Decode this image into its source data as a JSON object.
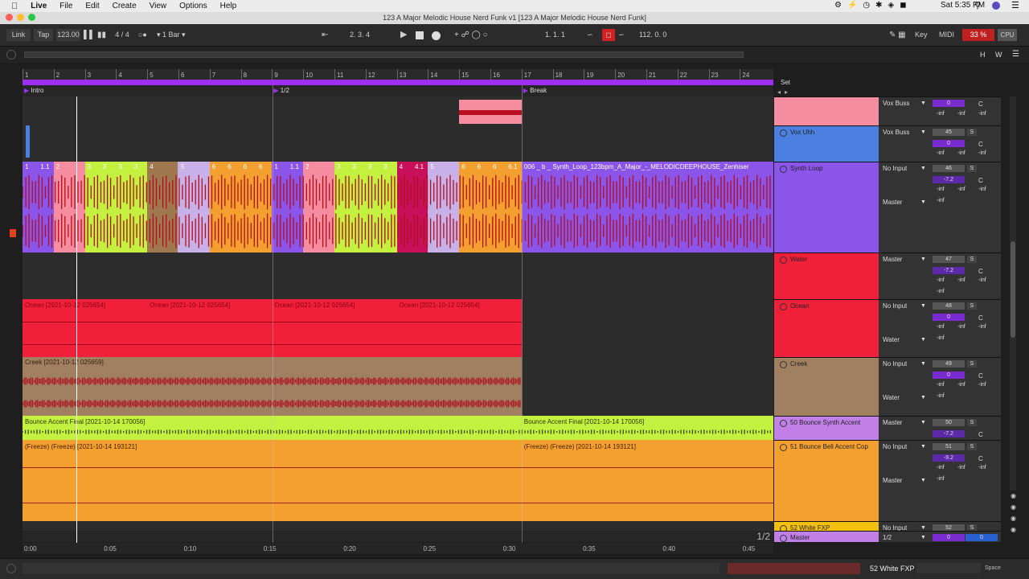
{
  "menubar": {
    "app": "Live",
    "items": [
      "File",
      "Edit",
      "Create",
      "View",
      "Options",
      "Help"
    ],
    "clock": "Sat 5:35 PM"
  },
  "window": {
    "title": "123 A Major Melodic House Nerd Funk v1  [123 A Major Melodic House Nerd Funk]"
  },
  "transport": {
    "link": "Link",
    "tap": "Tap",
    "tempo": "123.00",
    "signature": "4 / 4",
    "quantize": "1 Bar",
    "position": "2.  3.  4",
    "loop_start": "1.   1.   1",
    "loop_length": "112.   0.   0",
    "key": "Key",
    "midi": "MIDI",
    "cpu_pct": "33 %",
    "cpu": "CPU"
  },
  "view": {
    "h": "H",
    "w": "W",
    "set": "Set"
  },
  "ruler": [
    "1",
    "2",
    "3",
    "4",
    "5",
    "6",
    "7",
    "8",
    "9",
    "10",
    "11",
    "12",
    "13",
    "14",
    "15",
    "16",
    "17",
    "18",
    "19",
    "20",
    "21",
    "22",
    "23",
    "24"
  ],
  "locators": [
    {
      "label": "Intro",
      "bar": 1
    },
    {
      "label": "1/2",
      "bar": 9
    },
    {
      "label": "Break",
      "bar": 17
    }
  ],
  "clips": {
    "synth_loop_bars": [
      "1",
      "1.1",
      "2",
      "",
      "3",
      "3",
      "3",
      "3",
      "4",
      "",
      "5",
      "",
      "6",
      "6",
      "6",
      "6",
      "1",
      "1.1",
      "2",
      "",
      "3",
      "3",
      "3",
      "3",
      "4",
      "4.1",
      "5",
      "",
      "6",
      "6",
      "6",
      "6.1"
    ],
    "synth_loop_name": "006 _ b _ Synth_Loop_123bpm_A_Major_-_MELODICDEEPHOUSE_Zenhiser",
    "ocean": [
      "Ocean [2021-10-12 025654]",
      "Ocean [2021-10-12 025654]",
      "Ocean [2021-10-12 025654]",
      "Ocean [2021-10-12 025654]"
    ],
    "creek": "Creek [2021-10-12 025659]",
    "bounce": [
      "Bounce Accent Final [2021-10-14 170056]",
      "Bounce Accent Final [2021-10-14 170056]"
    ],
    "freeze": [
      "(Freeze) (Freeze) [2021-10-14 193121]",
      "(Freeze) (Freeze) [2021-10-14 193121]"
    ]
  },
  "tracks": [
    {
      "name": "",
      "color": "#f68ca0",
      "io_top": "Vox Buss",
      "vol": "0",
      "vol_bg": "#7a2bd0",
      "s": "",
      "pan": "C",
      "infs": [
        "-inf",
        "-inf",
        "-inf"
      ]
    },
    {
      "name": "Vox Uhh",
      "color": "#4b7fe0",
      "io_top": "Vox Buss",
      "vol": "0",
      "vol_bg": "#7a2bd0",
      "s": "S",
      "num": "45",
      "pan": "C",
      "infs": [
        "-inf",
        "-inf",
        "-inf"
      ]
    },
    {
      "name": "Synth Loop",
      "color": "#8a55e8",
      "io_top": "No Input",
      "io_bottom": "Master",
      "num": "46",
      "vol": "-7.2",
      "vol_bg": "#5c2aa8",
      "s": "S",
      "pan": "C",
      "infs": [
        "-inf",
        "-inf",
        "-inf"
      ],
      "inf_solo": "-inf"
    },
    {
      "name": "Water",
      "color": "#f0203a",
      "io_top": "Master",
      "num": "47",
      "vol": "-7.2",
      "vol_bg": "#5c2aa8",
      "s": "S",
      "pan": "C",
      "infs": [
        "-inf",
        "-inf",
        "-inf"
      ],
      "inf_solo": "-inf"
    },
    {
      "name": "Ocean",
      "color": "#f0203a",
      "io_top": "No Input",
      "io_bottom": "Water",
      "num": "48",
      "vol": "0",
      "vol_bg": "#7a2bd0",
      "s": "S",
      "pan": "C",
      "infs": [
        "-inf",
        "-inf",
        "-inf"
      ],
      "inf_solo": "-inf"
    },
    {
      "name": "Creek",
      "color": "#a08060",
      "io_top": "No Input",
      "io_bottom": "Water",
      "num": "49",
      "vol": "0",
      "vol_bg": "#7a2bd0",
      "s": "S",
      "pan": "C",
      "infs": [
        "-inf",
        "-inf",
        "-inf"
      ],
      "inf_solo": "-inf"
    },
    {
      "name": "50 Bounce Synth Accent",
      "color": "#c080e8",
      "io_top": "Master",
      "num": "50",
      "vol": "-7.2",
      "vol_bg": "#5c2aa8",
      "s": "S",
      "pan": "C"
    },
    {
      "name": "51 Bounce Bell Accent Cop",
      "color": "#f4a030",
      "io_top": "No Input",
      "io_bottom": "Master",
      "num": "51",
      "vol": "-9.2",
      "vol_bg": "#5c2aa8",
      "s": "S",
      "pan": "C",
      "infs": [
        "-inf",
        "-inf",
        "-inf"
      ],
      "inf_solo": "-inf"
    },
    {
      "name": "52 White FXP",
      "color": "#f4c010",
      "io_top": "No Input",
      "num": "52",
      "s": "S"
    },
    {
      "name": "Master",
      "color": "#c080e8",
      "io_top": "1/2",
      "vol": "0",
      "vol_bg": "#7a2bd0",
      "vol2": "0"
    }
  ],
  "timeaxis": [
    "0:00",
    "0:05",
    "0:10",
    "0:15",
    "0:20",
    "0:25",
    "0:30",
    "0:35",
    "0:40",
    "0:45"
  ],
  "zoom": "1/2",
  "status": {
    "selected": "52 White FXP",
    "space": "Space"
  },
  "colors": {
    "synth_wave": "#b0101c",
    "ocean": "#f0203a",
    "creek": "#a08060",
    "bounce": "#c4f040",
    "freeze": "#f4a030",
    "locator": "#9d2ff0"
  }
}
